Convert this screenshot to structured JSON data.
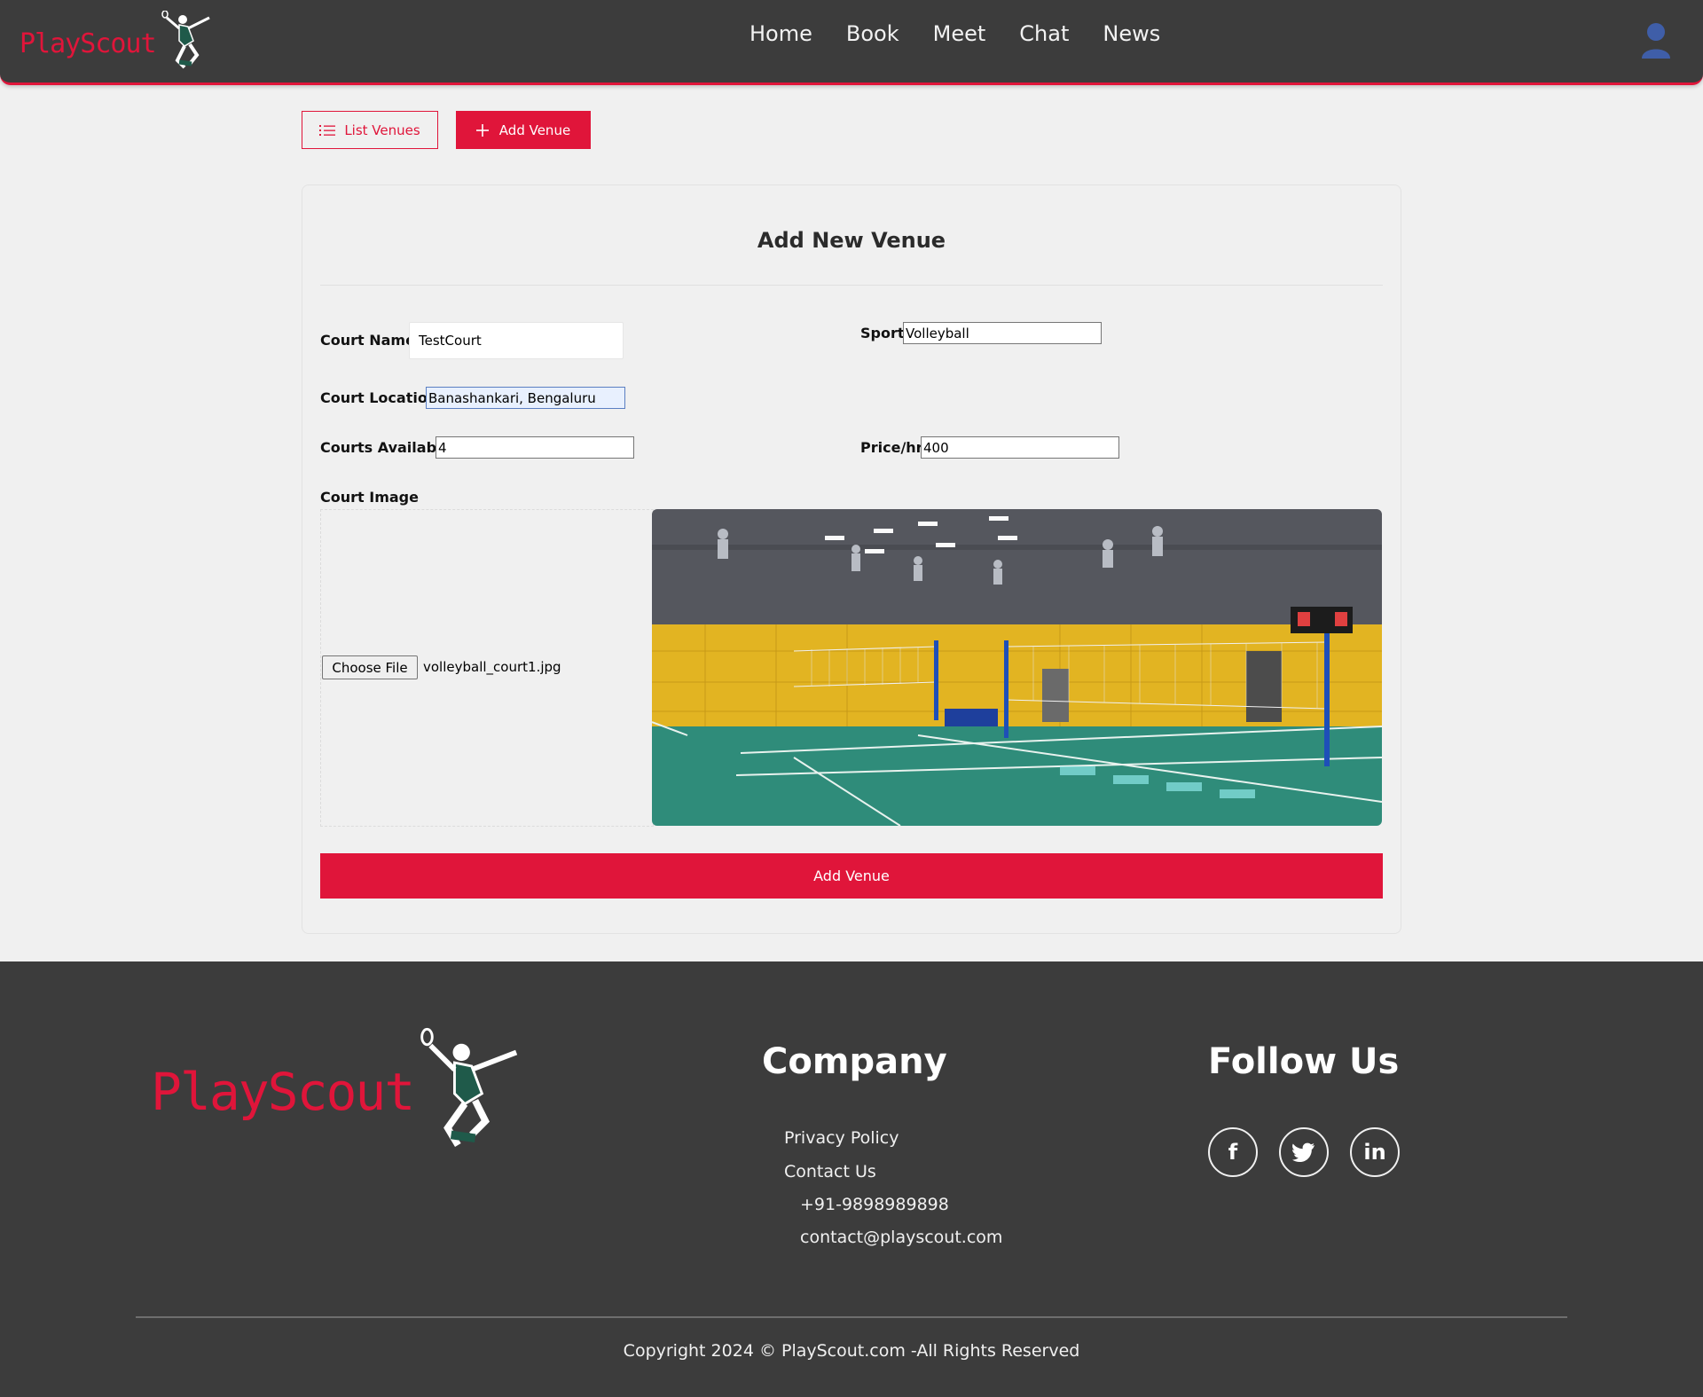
{
  "brand": {
    "name": "PlayScout",
    "accent": "#e0153a",
    "dark": "#3c3c3c"
  },
  "nav": {
    "items": [
      "Home",
      "Book",
      "Meet",
      "Chat",
      "News"
    ]
  },
  "toolbar": {
    "list_label": "List Venues",
    "add_label": "Add Venue",
    "list_icon": "list-icon",
    "add_icon": "plus-icon"
  },
  "form": {
    "title": "Add New Venue",
    "court_name": {
      "label": "Court Name",
      "value": "TestCourt"
    },
    "sport": {
      "label": "Sport",
      "value": "Volleyball"
    },
    "court_location": {
      "label": "Court Location",
      "value": "Banashankari, Bengaluru"
    },
    "courts_available": {
      "label": "Courts Available",
      "value": "4"
    },
    "price": {
      "label": "Price/hr",
      "value": "400"
    },
    "court_image": {
      "label": "Court Image",
      "choose_label": "Choose File",
      "file_name": "volleyball_court1.jpg"
    },
    "submit_label": "Add Venue"
  },
  "footer": {
    "company_heading": "Company",
    "links": [
      "Privacy Policy",
      "Contact Us"
    ],
    "phone": "+91-9898989898",
    "email": "contact@playscout.com",
    "follow_heading": "Follow Us",
    "social": [
      {
        "name": "facebook-icon",
        "glyph": "f"
      },
      {
        "name": "twitter-icon",
        "glyph": ""
      },
      {
        "name": "linkedin-icon",
        "glyph": "in"
      }
    ],
    "copyright": "Copyright 2024 © PlayScout.com -All Rights Reserved"
  }
}
